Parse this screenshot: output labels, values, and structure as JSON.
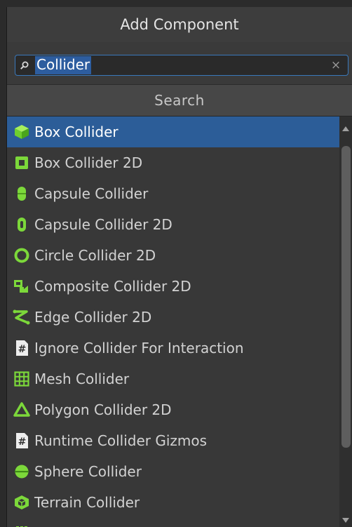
{
  "header": {
    "title": "Add Component"
  },
  "search": {
    "value": "Collider",
    "clear_glyph": "×"
  },
  "section": {
    "title": "Search"
  },
  "colors": {
    "accent": "#2c5d98",
    "icon_green": "#7cd83a"
  },
  "items": [
    {
      "label": "Box Collider",
      "icon": "box-collider-icon",
      "selected": true
    },
    {
      "label": "Box Collider 2D",
      "icon": "box-collider-2d-icon"
    },
    {
      "label": "Capsule Collider",
      "icon": "capsule-collider-icon"
    },
    {
      "label": "Capsule Collider 2D",
      "icon": "capsule-collider-2d-icon"
    },
    {
      "label": "Circle Collider 2D",
      "icon": "circle-collider-2d-icon"
    },
    {
      "label": "Composite Collider 2D",
      "icon": "composite-collider-2d-icon"
    },
    {
      "label": "Edge Collider 2D",
      "icon": "edge-collider-2d-icon"
    },
    {
      "label": "Ignore Collider For Interaction",
      "icon": "script-icon"
    },
    {
      "label": "Mesh Collider",
      "icon": "mesh-collider-icon"
    },
    {
      "label": "Polygon Collider 2D",
      "icon": "polygon-collider-2d-icon"
    },
    {
      "label": "Runtime Collider Gizmos",
      "icon": "script-icon"
    },
    {
      "label": "Sphere Collider",
      "icon": "sphere-collider-icon"
    },
    {
      "label": "Terrain Collider",
      "icon": "terrain-collider-icon"
    }
  ]
}
